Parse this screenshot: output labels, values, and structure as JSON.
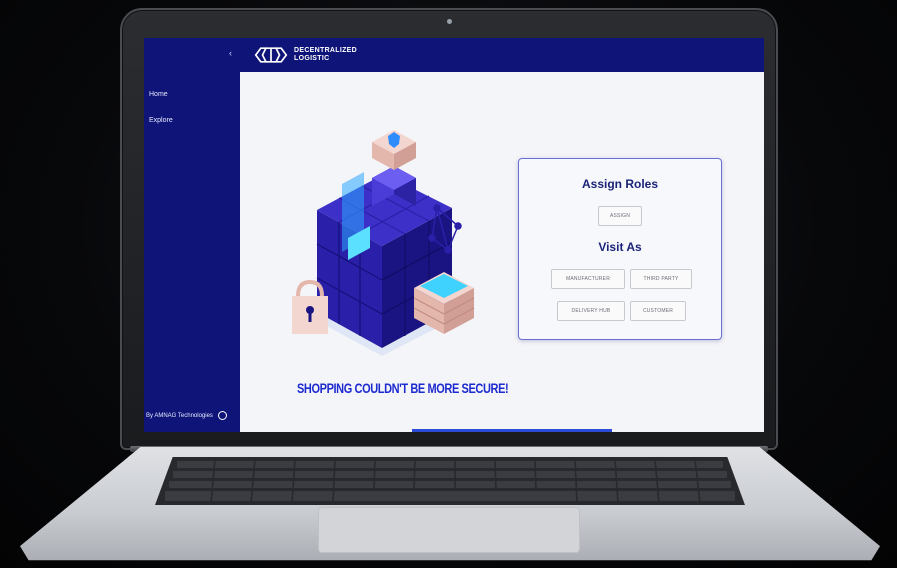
{
  "sidebar": {
    "collapse_glyph": "‹",
    "items": [
      {
        "label": "Home"
      },
      {
        "label": "Explore"
      }
    ],
    "footer_text": "By AMNAG Technologies"
  },
  "header": {
    "brand_line1": "DECENTRALIZED",
    "brand_line2": "LOGISTIC"
  },
  "hero": {
    "tagline": "SHOPPING COULDN'T BE MORE SECURE!"
  },
  "card": {
    "assign_title": "Assign Roles",
    "assign_button": "ASSIGN",
    "visit_title": "Visit As",
    "visit_buttons": [
      {
        "label": "MANUFACTURER"
      },
      {
        "label": "THIRD PARTY"
      },
      {
        "label": "DELIVERY HUB"
      },
      {
        "label": "CUSTOMER"
      }
    ]
  },
  "colors": {
    "sidebar_bg": "#0f1478",
    "header_bg": "#0f1478",
    "accent": "#1d2ad0",
    "card_border": "#6a6fd6"
  }
}
